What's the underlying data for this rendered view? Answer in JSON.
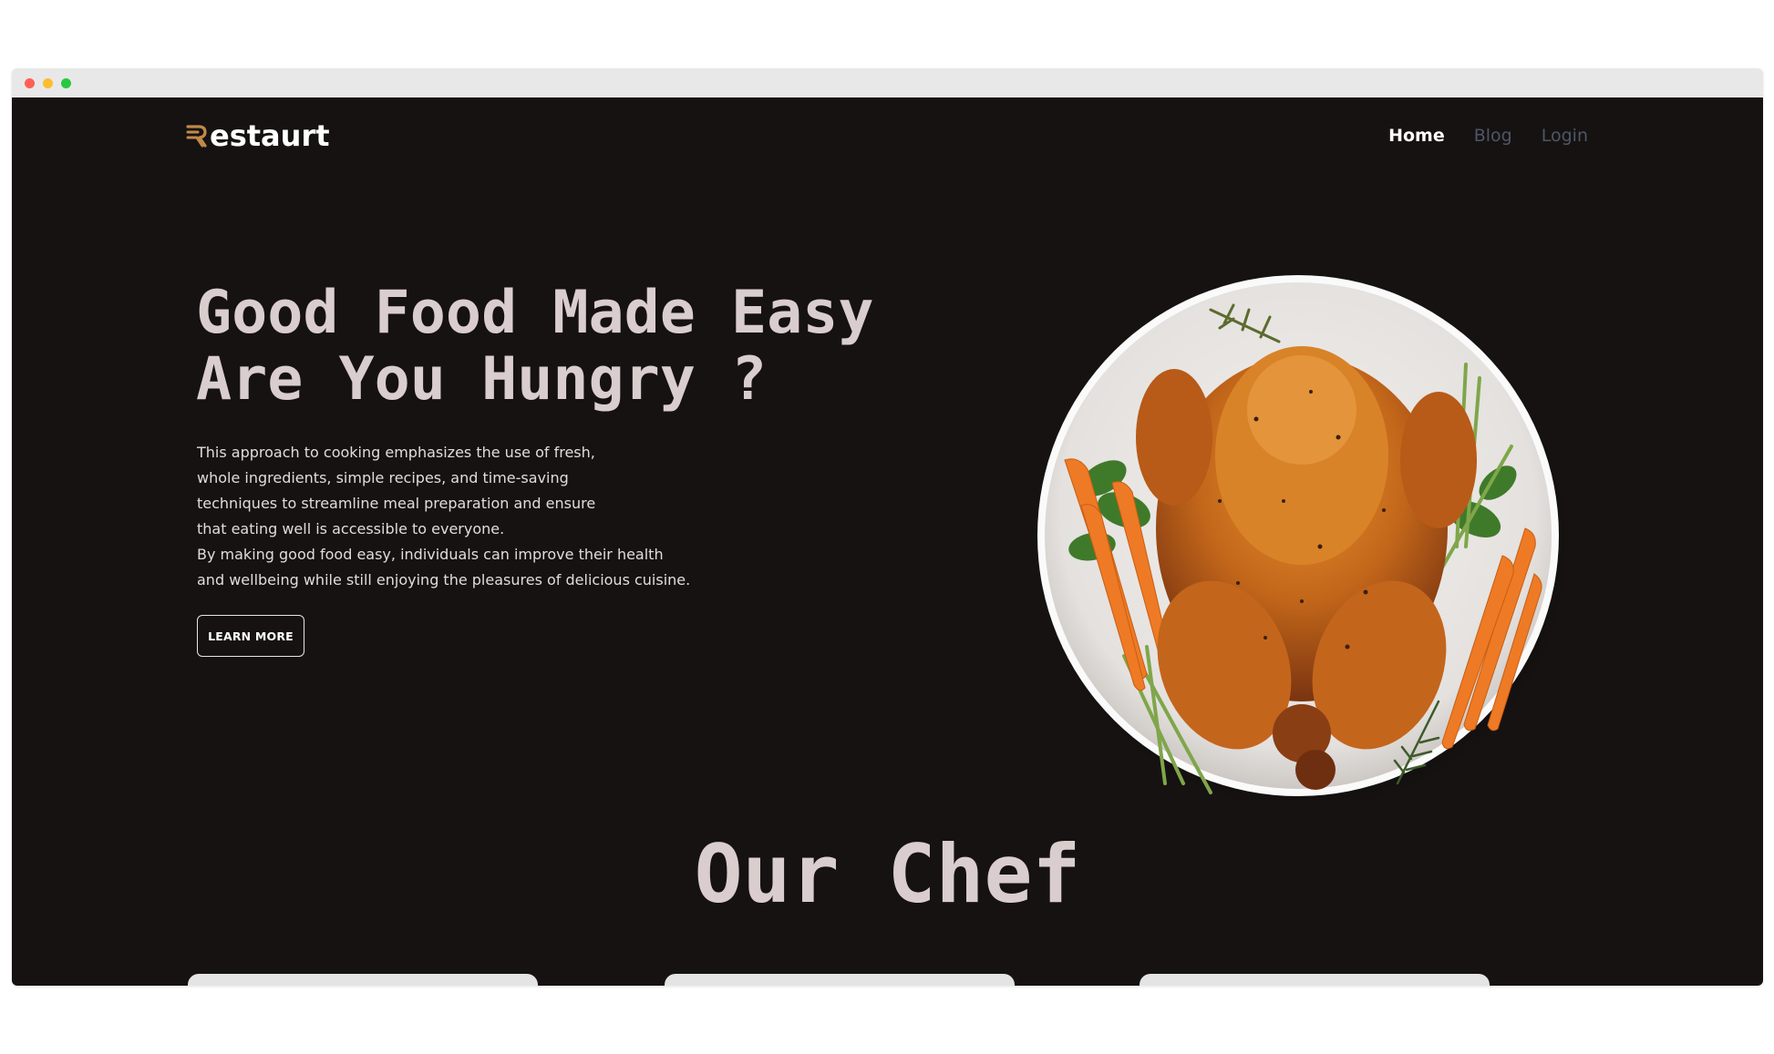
{
  "brand": {
    "name": "Restaurt",
    "name_rest": "estaurt",
    "accent_color": "#c0894a"
  },
  "nav": {
    "items": [
      "Home",
      "Blog",
      "Login"
    ]
  },
  "hero": {
    "title_lines": [
      "Good Food Made Easy",
      "Are You Hungry ?"
    ],
    "description_lines": [
      "This approach to cooking emphasizes the use of fresh,",
      "whole ingredients, simple recipes, and time-saving",
      "techniques to streamline meal preparation and ensure",
      "that eating well is accessible to everyone.",
      "By making good food easy, individuals can improve their health",
      "and wellbeing while still enjoying the pleasures of delicious cuisine."
    ],
    "button_label": "LEARN MORE"
  },
  "chef_section": {
    "title": "Our Chef"
  },
  "colors": {
    "background": "#161212",
    "heading": "#d9cdcd",
    "nav_muted": "#4e5666"
  }
}
